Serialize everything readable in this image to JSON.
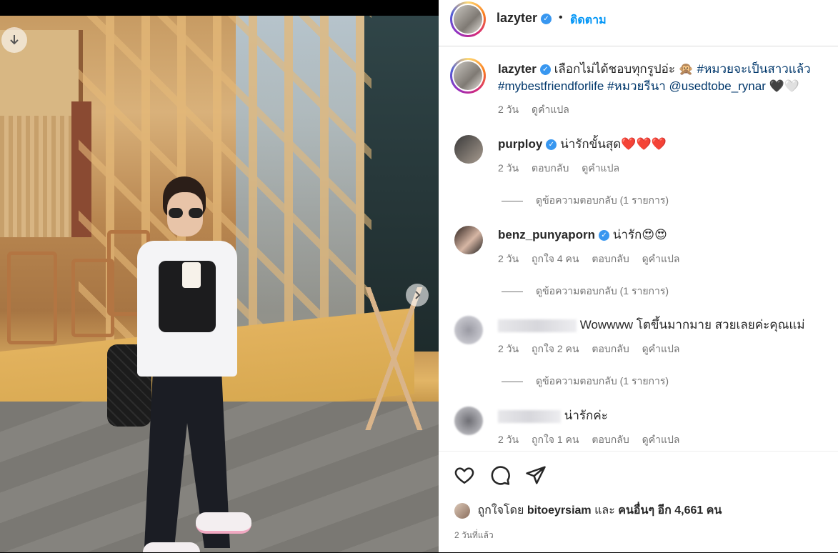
{
  "post": {
    "username": "lazyter",
    "follow_label": "ติดตาม",
    "caption_text": "เลือกไม่ได้ชอบทุกรูปอ่ะ 🙊",
    "caption_tags": [
      "#หมวยจะเป็นสาวแล้ว",
      "#mybestfriendforlife",
      "#หมวยรีนา",
      "@usedtobe_rynar"
    ],
    "caption_emoji": "🖤🤍",
    "caption_time": "2 วัน",
    "caption_translate": "ดูคำแปล"
  },
  "comments": [
    {
      "username": "purploy",
      "verified": true,
      "text": "น่ารักขั้นสุด❤️❤️❤️",
      "time": "2 วัน",
      "likes": "",
      "reply": "ตอบกลับ",
      "translate": "ดูคำแปล",
      "replies": "ดูข้อความตอบกลับ (1 รายการ)"
    },
    {
      "username": "benz_punyaporn",
      "verified": true,
      "text": "น่ารัก😍😍",
      "time": "2 วัน",
      "likes": "ถูกใจ 4 คน",
      "reply": "ตอบกลับ",
      "translate": "ดูคำแปล",
      "replies": "ดูข้อความตอบกลับ (1 รายการ)"
    },
    {
      "username": "",
      "verified": false,
      "text": "Wowwww โตขึ้นมากมาย สวยเลยค่ะคุณแม่",
      "time": "2 วัน",
      "likes": "ถูกใจ 2 คน",
      "reply": "ตอบกลับ",
      "translate": "ดูคำแปล",
      "replies": "ดูข้อความตอบกลับ (1 รายการ)"
    },
    {
      "username": "",
      "verified": false,
      "text": "น่ารักค่ะ",
      "time": "2 วัน",
      "likes": "ถูกใจ 1 คน",
      "reply": "ตอบกลับ",
      "translate": "ดูคำแปล",
      "replies": ""
    }
  ],
  "footer": {
    "liked_by_prefix": "ถูกใจโดย",
    "liked_by_user": "bitoeyrsiam",
    "liked_by_and": "และ",
    "liked_by_others": "คนอื่นๆ อีก 4,661 คน",
    "time_ago": "2 วันที่แล้ว"
  },
  "icons": [
    "heart-icon",
    "comment-icon",
    "share-icon",
    "download-icon",
    "next-icon",
    "verified-icon"
  ],
  "colors": {
    "link": "#0095f6",
    "tag": "#00376b",
    "verified": "#3897f0"
  }
}
